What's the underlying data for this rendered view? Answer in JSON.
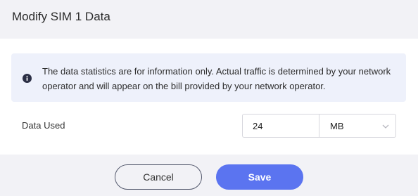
{
  "dialog": {
    "title": "Modify SIM 1 Data"
  },
  "notice": {
    "icon": "info-icon",
    "text": "The data statistics are for information only. Actual traffic is determined by your network operator and will appear on the bill provided by your network operator."
  },
  "form": {
    "data_used_label": "Data Used",
    "data_used_value": "24",
    "unit_selected": "MB"
  },
  "footer": {
    "cancel_label": "Cancel",
    "save_label": "Save"
  },
  "colors": {
    "accent": "#5b74f0",
    "notice_bg": "#eef1fb",
    "panel_bg": "#f2f2f6"
  }
}
